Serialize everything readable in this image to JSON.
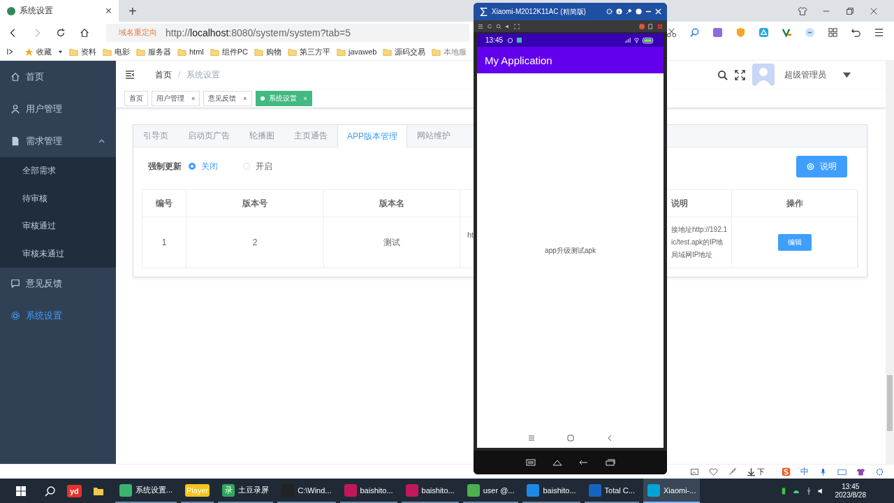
{
  "browser": {
    "tab_title": "系统设置",
    "tab_close": "×",
    "new_tab": "+",
    "redirect_label": "域名重定向",
    "url": "http://**localhost**:8080/system/system?tab=5",
    "bookmarks": [
      "收藏",
      "资料",
      "电影",
      "服务器",
      "html",
      "组件PC",
      "购物",
      "第三方平",
      "javaweb",
      "源码交易",
      "本地服"
    ]
  },
  "sidebar": {
    "items": [
      {
        "label": "首页",
        "selected": false
      },
      {
        "label": "用户管理",
        "selected": false
      },
      {
        "label": "需求管理",
        "selected": false,
        "expanded": true,
        "children": [
          {
            "label": "全部需求",
            "selected": false
          },
          {
            "label": "待审核",
            "selected": false
          },
          {
            "label": "审核通过",
            "selected": false
          },
          {
            "label": "审核未通过",
            "selected": false
          }
        ]
      },
      {
        "label": "意见反馈",
        "selected": false
      },
      {
        "label": "系统设置",
        "selected": true
      }
    ]
  },
  "header": {
    "breadcrumb": [
      "首页",
      "系统设置"
    ],
    "separator": "/",
    "user": "超级管理员"
  },
  "tags": [
    {
      "label": "首页",
      "closable": false,
      "selected": false
    },
    {
      "label": "用户管理",
      "closable": true,
      "selected": false
    },
    {
      "label": "意见反馈",
      "closable": true,
      "selected": false
    },
    {
      "label": "系统设置",
      "closable": true,
      "selected": true
    }
  ],
  "tag_close": "×",
  "settings_tabs": [
    {
      "label": "引导页",
      "selected": false
    },
    {
      "label": "启动页广告",
      "selected": false
    },
    {
      "label": "轮播图",
      "selected": false
    },
    {
      "label": "主页通告",
      "selected": false
    },
    {
      "label": "APP版本管理",
      "selected": true
    },
    {
      "label": "网站维护",
      "selected": false
    }
  ],
  "force_update": {
    "label": "强制更新",
    "options": [
      {
        "label": "关闭",
        "selected": true
      },
      {
        "label": "开启",
        "selected": false
      }
    ]
  },
  "help_button": "说明",
  "table": {
    "columns": [
      "编号",
      "版本号",
      "版本名",
      "说明",
      "操作"
    ],
    "rows": [
      {
        "id": "1",
        "version_code": "2",
        "version_name": "测试",
        "column_4": "ht",
        "description": [
          "接地址http://192.1",
          "ic/test.apk的IP地",
          "局域网IP地址"
        ],
        "action": "编辑"
      }
    ]
  },
  "phone": {
    "window_title": "Xiaomi-M2012K11AC (精简版)",
    "time": "13:45",
    "app_title": "My Application",
    "message": "app升级测试apk"
  },
  "bottom_strip": {
    "download": "下",
    "ime": "中"
  },
  "taskbar": {
    "pinned": "yd",
    "apps": [
      {
        "label": "系统设置...",
        "selected": false
      },
      {
        "icon_text": "Player",
        "selected": false
      },
      {
        "label": "土豆录屏",
        "icon_text": "录",
        "selected": false
      },
      {
        "label": "C:\\Wind...",
        "selected": false
      },
      {
        "label": "baishito...",
        "selected": false
      },
      {
        "label": "baishito...",
        "selected": false
      },
      {
        "label": "user @...",
        "selected": false
      },
      {
        "label": "baishito...",
        "selected": false
      },
      {
        "label": "Total C...",
        "selected": false
      },
      {
        "label": "Xiaomi-...",
        "selected": true
      }
    ],
    "time": "13:45",
    "date": "2023/8/28"
  }
}
